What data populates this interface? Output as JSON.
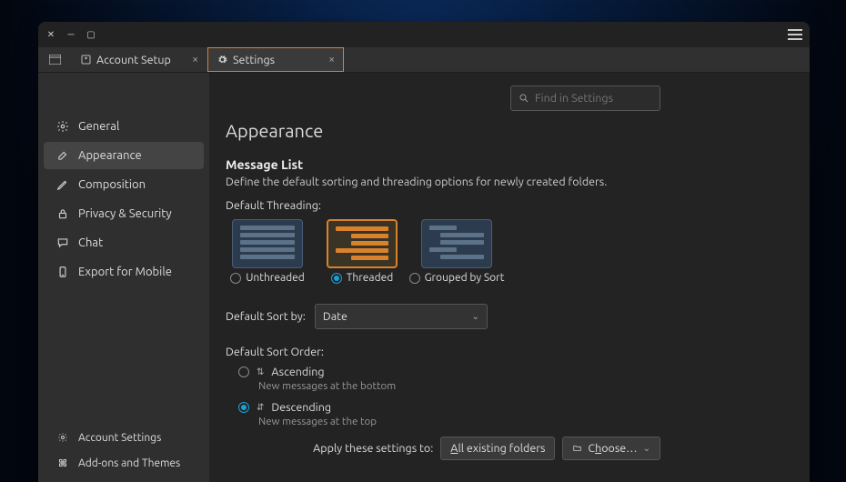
{
  "tabs": [
    {
      "label": "Account Setup",
      "active": false
    },
    {
      "label": "Settings",
      "active": true
    }
  ],
  "search": {
    "placeholder": "Find in Settings"
  },
  "sidebar": {
    "items": [
      {
        "label": "General",
        "icon": "gear-icon"
      },
      {
        "label": "Appearance",
        "icon": "brush-icon"
      },
      {
        "label": "Composition",
        "icon": "pencil-icon"
      },
      {
        "label": "Privacy & Security",
        "icon": "lock-icon"
      },
      {
        "label": "Chat",
        "icon": "chat-icon"
      },
      {
        "label": "Export for Mobile",
        "icon": "export-icon"
      }
    ],
    "active_index": 1,
    "footer": [
      {
        "label": "Account Settings",
        "icon": "gear-icon"
      },
      {
        "label": "Add-ons and Themes",
        "icon": "puzzle-icon"
      }
    ]
  },
  "page": {
    "title": "Appearance",
    "section_title": "Message List",
    "section_desc": "Define the default sorting and threading options for newly created folders.",
    "threading_label": "Default Threading:",
    "threading_options": [
      {
        "label": "Unthreaded"
      },
      {
        "label": "Threaded"
      },
      {
        "label": "Grouped by Sort"
      }
    ],
    "threading_selected": 1,
    "sort_by_label": "Default Sort by:",
    "sort_by_value": "Date",
    "sort_order_label": "Default Sort Order:",
    "order_options": [
      {
        "label": "Ascending",
        "hint": "New messages at the bottom"
      },
      {
        "label": "Descending",
        "hint": "New messages at the top"
      }
    ],
    "order_selected": 1,
    "apply_label": "Apply these settings to:",
    "apply_all_btn": "All existing folders",
    "choose_btn": "Choose…"
  }
}
